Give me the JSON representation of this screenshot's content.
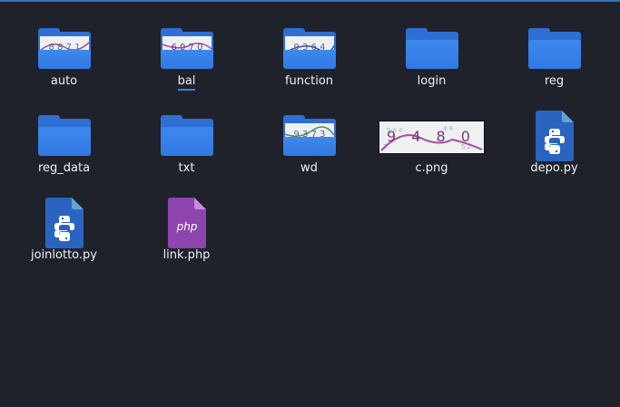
{
  "files": [
    {
      "name": "auto",
      "type": "folder",
      "preview_text": "8 8 7 1"
    },
    {
      "name": "bal",
      "type": "folder",
      "preview_text": "6 0 7 0",
      "selected": true
    },
    {
      "name": "function",
      "type": "folder",
      "preview_text": "9 3 6 4"
    },
    {
      "name": "login",
      "type": "folder"
    },
    {
      "name": "reg",
      "type": "folder"
    },
    {
      "name": "reg_data",
      "type": "folder"
    },
    {
      "name": "txt",
      "type": "folder"
    },
    {
      "name": "wd",
      "type": "folder",
      "preview_text": "9 3 7 3"
    },
    {
      "name": "c.png",
      "type": "image",
      "preview_text": "9 4 8 0"
    },
    {
      "name": "depo.py",
      "type": "python",
      "icon": "python-icon"
    },
    {
      "name": "joinlotto.py",
      "type": "python",
      "icon": "python-icon"
    },
    {
      "name": "link.php",
      "type": "php",
      "icon": "php-icon",
      "badge": "php"
    }
  ],
  "colors": {
    "background": "#1f222b",
    "folder": "#3079e2",
    "python": "#2b64c0",
    "php": "#8e45ad",
    "selection": "#3b7edb"
  }
}
